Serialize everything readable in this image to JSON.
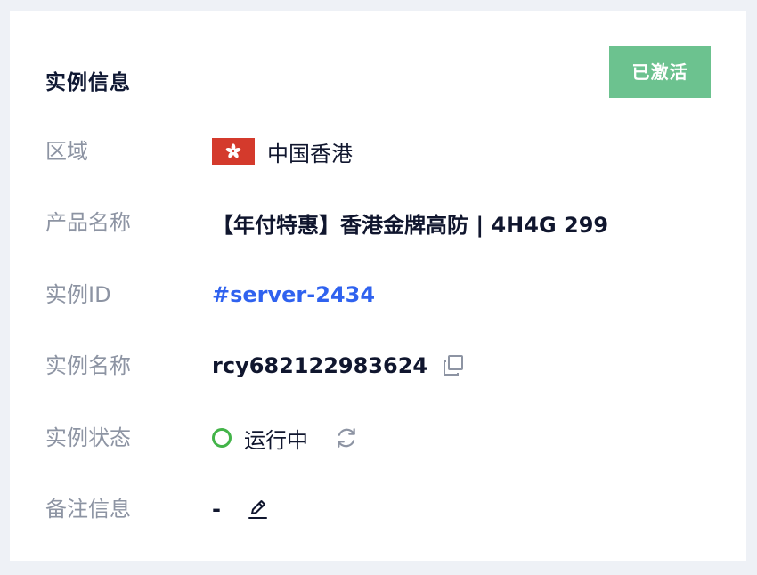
{
  "card": {
    "title": "实例信息",
    "status_badge": "已激活"
  },
  "rows": {
    "region": {
      "label": "区域",
      "value": "中国香港"
    },
    "product_name": {
      "label": "产品名称",
      "value": "【年付特惠】香港金牌高防 | 4H4G 299"
    },
    "instance_id": {
      "label": "实例ID",
      "value": "#server-2434"
    },
    "instance_name": {
      "label": "实例名称",
      "value": "rcy682122983624"
    },
    "instance_status": {
      "label": "实例状态",
      "value": "运行中"
    },
    "remark": {
      "label": "备注信息",
      "value": "-"
    }
  },
  "colors": {
    "badge_bg": "#6cc28f",
    "link": "#2f62ef",
    "running": "#43b449",
    "flag_red": "#d43a2c"
  },
  "icons": {
    "flag": "hong-kong-flag-icon",
    "copy": "copy-icon",
    "refresh": "refresh-icon",
    "edit": "edit-pencil-icon",
    "status": "status-circle-icon"
  }
}
